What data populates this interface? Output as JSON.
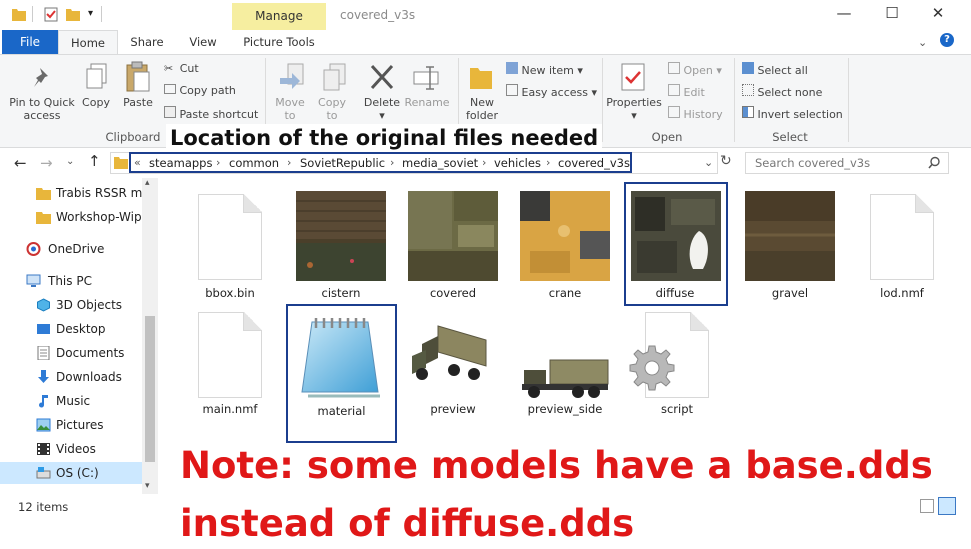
{
  "window": {
    "title": "covered_v3s",
    "context_tab": "Manage"
  },
  "tabs": {
    "file": "File",
    "home": "Home",
    "share": "Share",
    "view": "View",
    "picture_tools": "Picture Tools"
  },
  "ribbon": {
    "pin_label": "Pin to Quick access",
    "copy_label": "Copy",
    "paste_label": "Paste",
    "cut_label": "Cut",
    "copy_path_label": "Copy path",
    "paste_shortcut_label": "Paste shortcut",
    "clipboard_group": "Clipboard",
    "move_to_label": "Move to",
    "copy_to_label": "Copy to",
    "delete_label": "Delete",
    "rename_label": "Rename",
    "new_folder_label": "New folder",
    "new_item_label": "New item",
    "easy_access_label": "Easy access",
    "properties_label": "Properties",
    "open_label": "Open",
    "edit_label": "Edit",
    "history_label": "History",
    "open_group": "Open",
    "select_all_label": "Select all",
    "select_none_label": "Select none",
    "invert_selection_label": "Invert selection",
    "select_group": "Select"
  },
  "address": {
    "prefix": "«",
    "path": [
      "steamapps",
      "common",
      "SovietRepublic",
      "media_soviet",
      "vehicles",
      "covered_v3s"
    ],
    "search_placeholder": "Search covered_v3s"
  },
  "nav": {
    "items": [
      {
        "label": "Trabis RSSR moc",
        "icon": "folder-icon"
      },
      {
        "label": "Workshop-Wip",
        "icon": "folder-icon"
      },
      {
        "label": "OneDrive",
        "icon": "onedrive-icon"
      },
      {
        "label": "This PC",
        "icon": "pc-icon"
      },
      {
        "label": "3D Objects",
        "icon": "cube-icon"
      },
      {
        "label": "Desktop",
        "icon": "desktop-icon"
      },
      {
        "label": "Documents",
        "icon": "documents-icon"
      },
      {
        "label": "Downloads",
        "icon": "download-icon"
      },
      {
        "label": "Music",
        "icon": "music-icon"
      },
      {
        "label": "Pictures",
        "icon": "pictures-icon"
      },
      {
        "label": "Videos",
        "icon": "videos-icon"
      },
      {
        "label": "OS (C:)",
        "icon": "drive-icon"
      }
    ]
  },
  "files": [
    {
      "name": "bbox.bin",
      "kind": "blank"
    },
    {
      "name": "cistern",
      "kind": "texture"
    },
    {
      "name": "covered",
      "kind": "texture"
    },
    {
      "name": "crane",
      "kind": "texture"
    },
    {
      "name": "diffuse",
      "kind": "texture"
    },
    {
      "name": "gravel",
      "kind": "texture"
    },
    {
      "name": "lod.nmf",
      "kind": "blank"
    },
    {
      "name": "main.nmf",
      "kind": "blank"
    },
    {
      "name": "material",
      "kind": "notepad"
    },
    {
      "name": "preview",
      "kind": "truck"
    },
    {
      "name": "preview_side",
      "kind": "truck-side"
    },
    {
      "name": "script",
      "kind": "gear"
    }
  ],
  "status": {
    "item_count": "12 items"
  },
  "annotations": {
    "location": "Location of the original files needed",
    "note_line1": "Note: some models have a base.dds",
    "note_line2": "instead of diffuse.dds"
  },
  "colors": {
    "accent": "#1a67c8",
    "highlight_border": "#1b3e8e",
    "note_red": "#e01818",
    "manage_tab": "#f6eea0"
  }
}
